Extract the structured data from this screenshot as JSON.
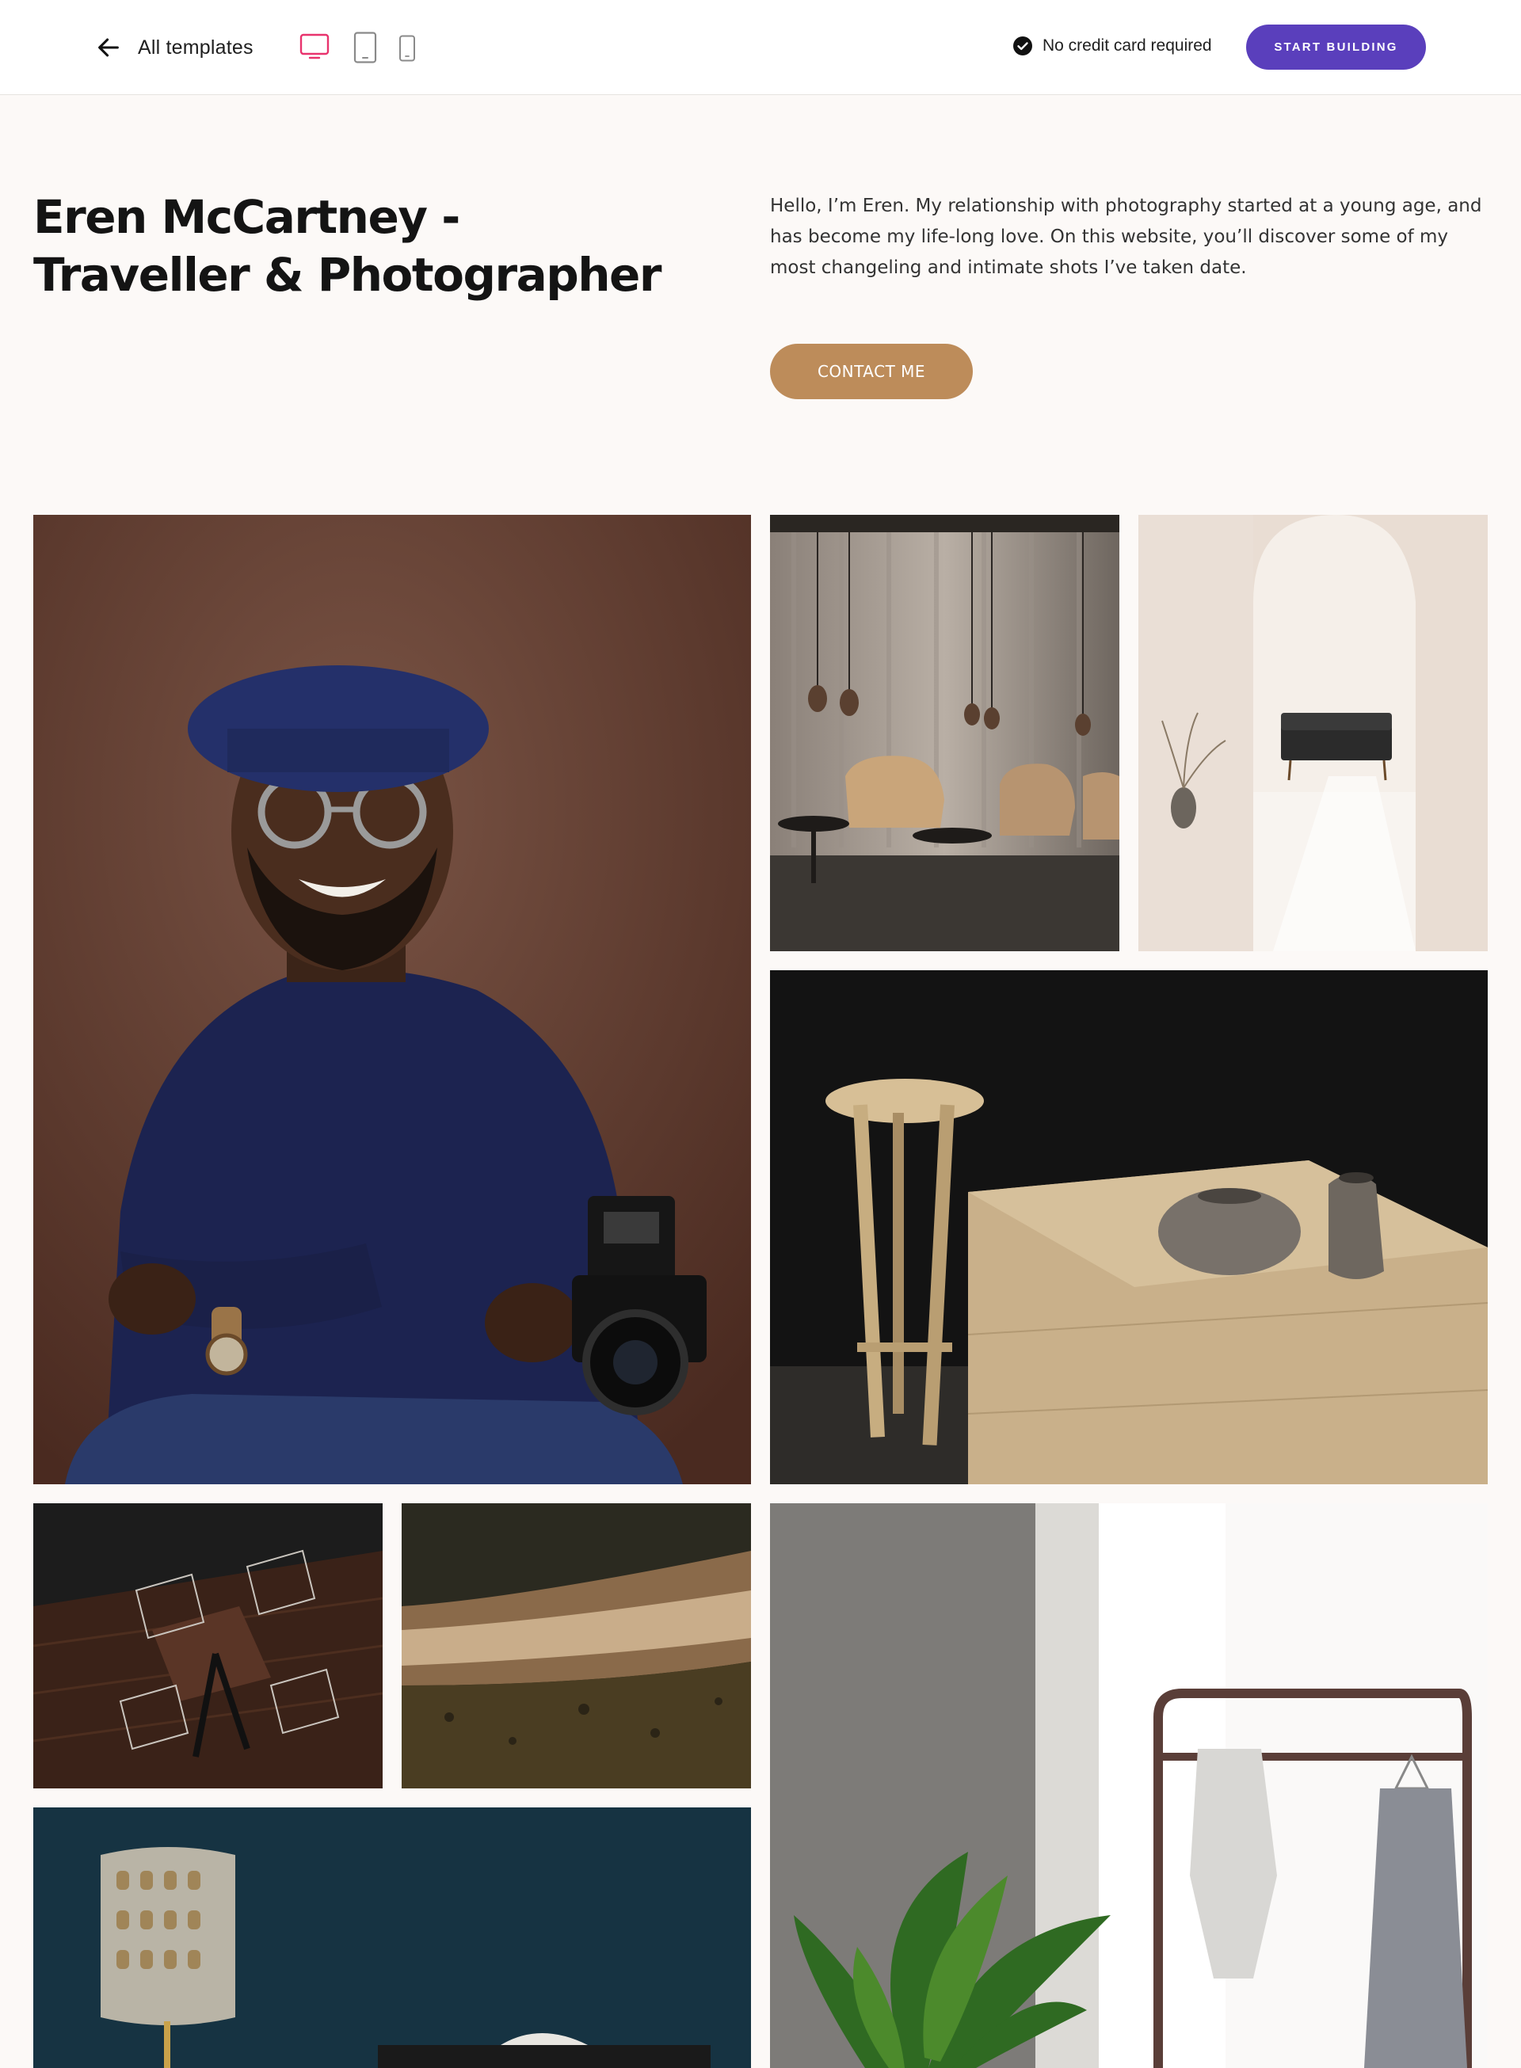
{
  "topbar": {
    "back_label": "All templates",
    "devices": [
      "desktop-icon",
      "tablet-icon",
      "mobile-icon"
    ],
    "active_device": "desktop",
    "badge_label": "No credit card required",
    "cta_label": "START BUILDING"
  },
  "hero": {
    "title": "Eren McCartney - Traveller & Photographer",
    "text": "Hello, I’m Eren. My relationship with photography started at a young age, and has become my life-long love. On this website, you’ll discover some of my most changeling and intimate shots I’ve taken date.",
    "contact_label": "CONTACT ME"
  },
  "colors": {
    "accent_purple": "#5a3fbc",
    "accent_pink": "#e8336d",
    "contact_brown": "#bd8c5a",
    "page_background": "#fcf9f7"
  }
}
